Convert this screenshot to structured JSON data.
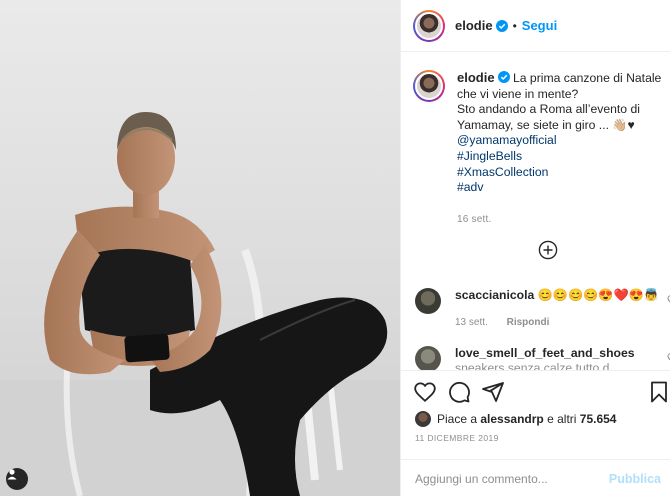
{
  "post": {
    "username": "elodie",
    "follow_label": "Segui",
    "separator": "•",
    "caption": {
      "line1": "La prima canzone di Natale che vi viene in mente?",
      "line2": "Sto andando a Roma all’evento di Yamamay, se siete in giro ... 👋🏼♥",
      "mention": "@yamamayofficial",
      "hashtags": [
        "#JingleBells",
        "#XmasCollection",
        "#adv"
      ]
    },
    "time_ago": "16 sett."
  },
  "comments": [
    {
      "username": "scaccianicola",
      "text": "😊😊😊😊😍❤️😍👼",
      "time": "13 sett.",
      "reply_label": "Rispondi"
    },
    {
      "username": "love_smell_of_feet_and_shoes",
      "text": "sneakers senza calze tutto d"
    }
  ],
  "likes": {
    "prefix": "Piace a",
    "user": "alessandrp",
    "connector": "e altri",
    "count": "75.654"
  },
  "date": "11 DICEMBRE 2019",
  "add_comment": {
    "placeholder": "Aggiungi un commento...",
    "publish_label": "Pubblica"
  },
  "colors": {
    "accent_blue": "#0095f6",
    "publish_disabled": "#b2dffc",
    "secondary_text": "#8e8e8e",
    "link": "#00376b"
  }
}
